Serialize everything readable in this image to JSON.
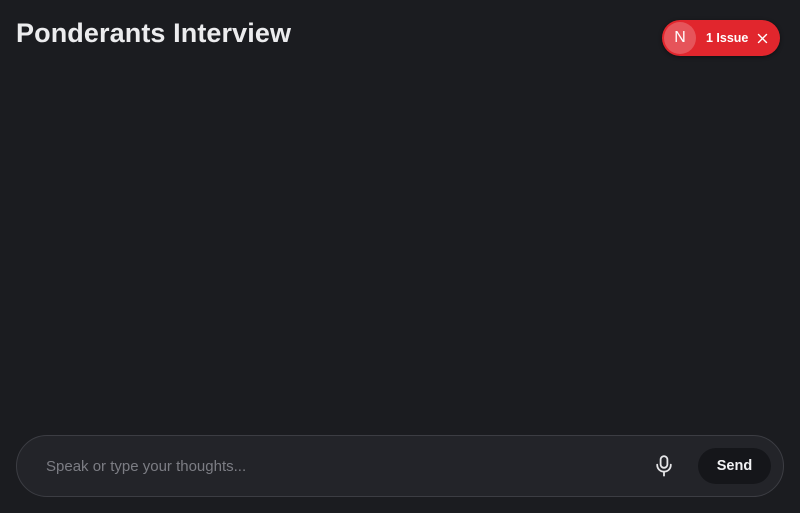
{
  "header": {
    "title": "Ponderants Interview"
  },
  "issue_badge": {
    "logo_letter": "N",
    "label": "1 Issue",
    "icon": "close-icon",
    "color": "#e1262d"
  },
  "composer": {
    "input_value": "",
    "input_placeholder": "Speak or type your thoughts...",
    "mic_icon": "microphone-icon",
    "send_label": "Send"
  },
  "colors": {
    "background": "#1b1c20",
    "composer_background": "#232429",
    "send_button": "#15161a"
  }
}
